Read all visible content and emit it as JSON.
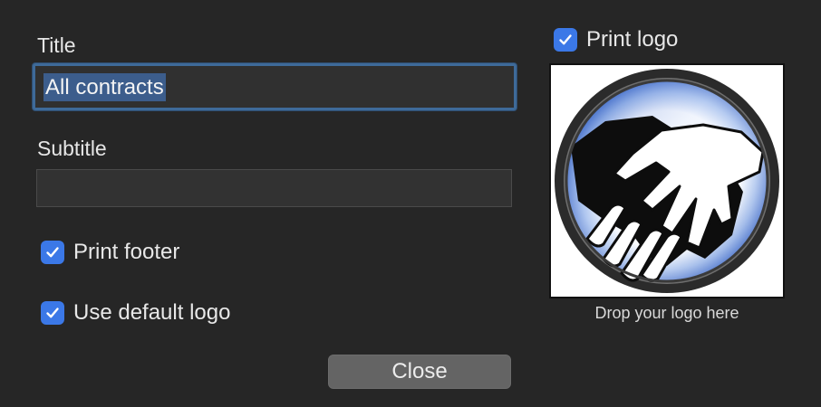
{
  "form": {
    "title_label": "Title",
    "title_value": "All contracts",
    "subtitle_label": "Subtitle",
    "subtitle_value": "",
    "print_footer_label": "Print footer",
    "print_footer_checked": true,
    "use_default_logo_label": "Use default logo",
    "use_default_logo_checked": true
  },
  "logo": {
    "print_logo_label": "Print logo",
    "print_logo_checked": true,
    "drop_caption": "Drop your logo here",
    "image_icon": "handshake-logo"
  },
  "footer": {
    "close_label": "Close"
  },
  "colors": {
    "background": "#262626",
    "checkbox_accent": "#3b78e7",
    "focus_ring": "#3e6a99",
    "selection": "#3c5d8c",
    "button": "#646464"
  }
}
